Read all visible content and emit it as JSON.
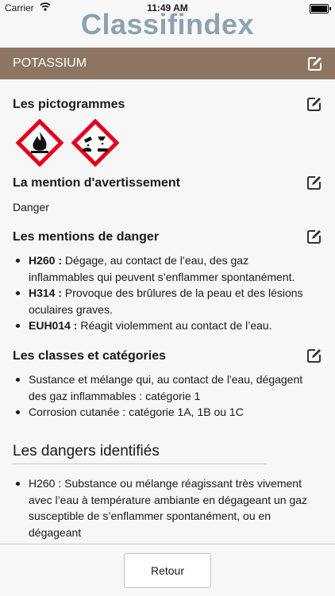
{
  "status_bar": {
    "carrier": "Carrier",
    "time": "11:49 AM"
  },
  "app": {
    "title": "Classifindex"
  },
  "substance": {
    "name": "POTASSIUM"
  },
  "sections": {
    "pictograms": {
      "title": "Les pictogrammes",
      "icons": [
        "ghs02-flame-icon",
        "ghs05-corrosion-icon"
      ]
    },
    "warning": {
      "title": "La mention d'avertissement",
      "value": "Danger"
    },
    "hazards": {
      "title": "Les mentions de danger",
      "items": [
        {
          "code": "H260 :",
          "text": " Dégage, au contact de l’eau, des gaz inflammables qui peuvent s’enflammer spontanément."
        },
        {
          "code": "H314 :",
          "text": " Provoque des brûlures de la peau et des lésions oculaires graves."
        },
        {
          "code": "EUH014 :",
          "text": " Réagit violemment au contact de l’eau."
        }
      ]
    },
    "classes": {
      "title": "Les classes et catégories",
      "items": [
        "Sustance et mélange qui, au contact de l'eau, dégagent des gaz inflammables : catégorie 1",
        "Corrosion cutanée : catégorie 1A, 1B ou 1C"
      ]
    },
    "dangers": {
      "title": "Les dangers identifiés",
      "items": [
        "H260 : Substance ou mélange réagissant très vivement avec l’eau à température ambiante en dégageant un gaz susceptible de s’enflammer spontanément, ou en dégageant"
      ]
    }
  },
  "footer": {
    "back_label": "Retour"
  },
  "colors": {
    "header_band": "#8c7562",
    "title": "#8fa1ae",
    "pictogram_border": "#e4001b"
  }
}
